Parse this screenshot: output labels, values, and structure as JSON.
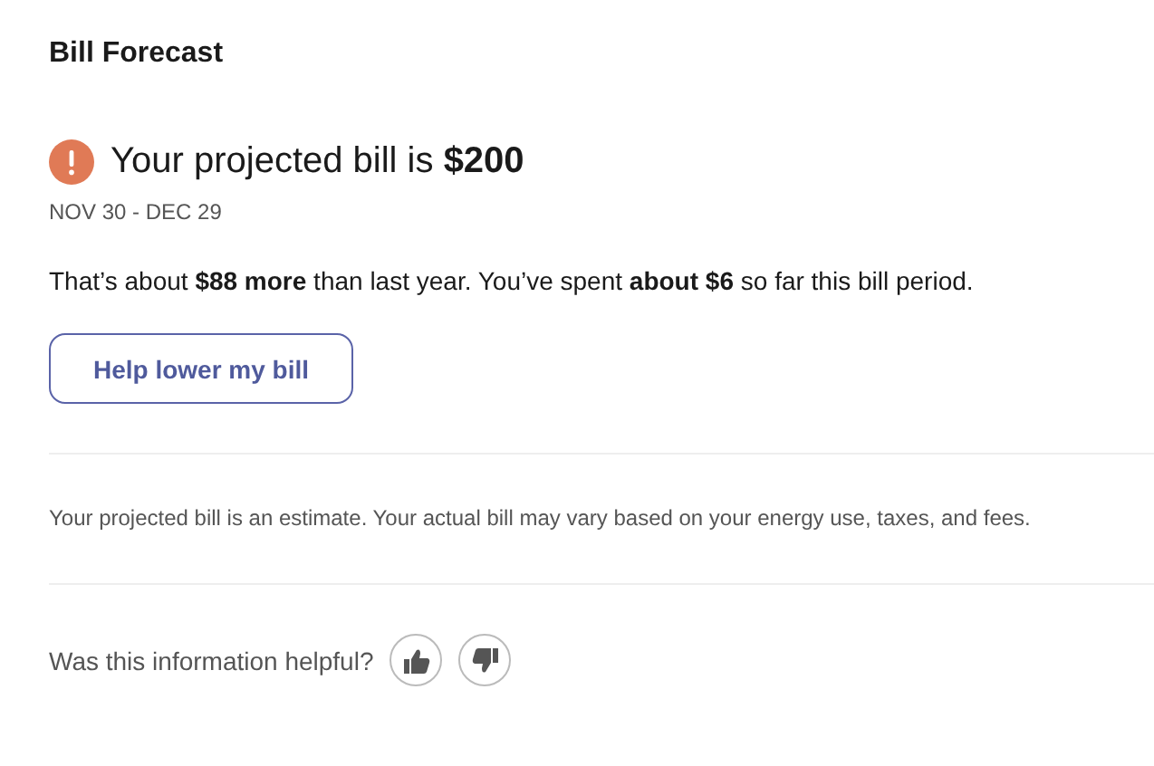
{
  "title": "Bill Forecast",
  "forecast": {
    "headline": "Your projected bill is **$200**",
    "period": "NOV 30 - DEC 29",
    "summary": "That’s about **$88 more** than last year. You’ve spent **about $6** so far this bill period."
  },
  "action_button": "Help lower my bill",
  "disclaimer": "Your projected bill is an estimate. Your actual bill may vary based on your energy use, taxes, and fees.",
  "feedback": {
    "question": "Was this information helpful?"
  }
}
